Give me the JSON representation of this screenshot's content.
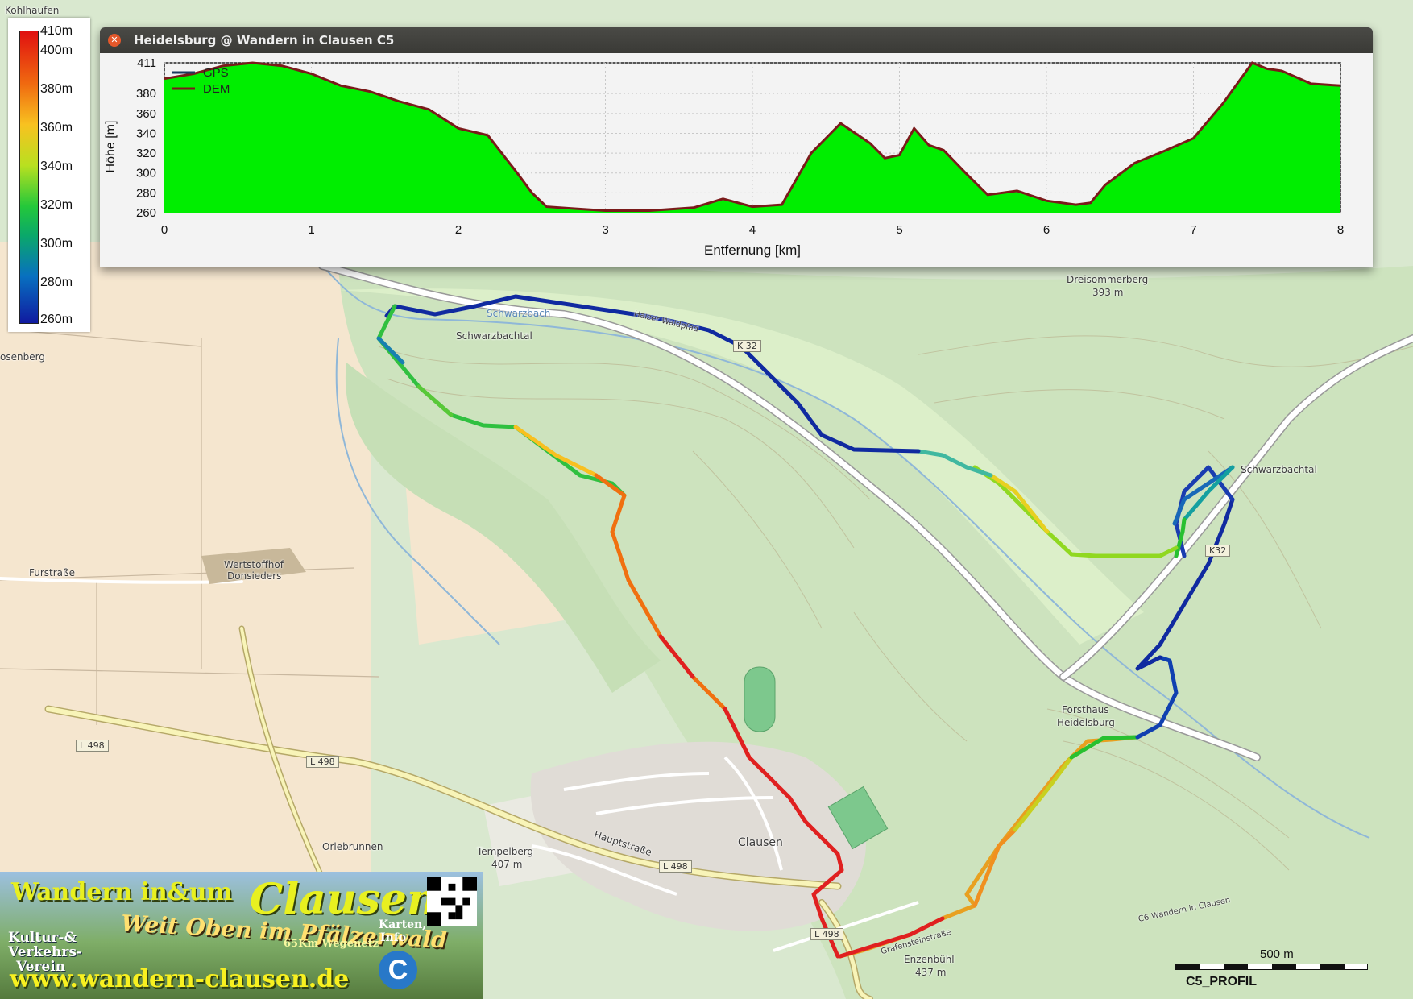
{
  "window": {
    "title": "Heidelsburg @ Wandern in Clausen C5"
  },
  "legend": {
    "ticks": [
      "410m",
      "400m",
      "380m",
      "360m",
      "340m",
      "320m",
      "300m",
      "280m",
      "260m"
    ]
  },
  "profile": {
    "ylabel": "Höhe [m]",
    "xlabel": "Entfernung [km]",
    "series_gps": "GPS",
    "series_dem": "DEM",
    "y_ticks": [
      "411",
      "380",
      "360",
      "340",
      "320",
      "300",
      "280",
      "260"
    ],
    "x_ticks": [
      "0",
      "1",
      "2",
      "3",
      "4",
      "5",
      "6",
      "7",
      "8"
    ]
  },
  "chart_data": {
    "type": "area",
    "xlabel": "Entfernung [km]",
    "ylabel": "Höhe [m]",
    "xlim": [
      0,
      8
    ],
    "ylim": [
      260,
      411
    ],
    "grid": true,
    "legend_position": "top-left",
    "series": [
      {
        "name": "DEM",
        "x": [
          0,
          0.2,
          0.4,
          0.6,
          0.8,
          1.0,
          1.2,
          1.4,
          1.6,
          1.8,
          2.0,
          2.2,
          2.4,
          2.5,
          2.6,
          2.8,
          3.0,
          3.3,
          3.6,
          3.8,
          4.0,
          4.2,
          4.4,
          4.6,
          4.8,
          4.9,
          5.0,
          5.1,
          5.2,
          5.3,
          5.45,
          5.6,
          5.8,
          6.0,
          6.2,
          6.3,
          6.4,
          6.6,
          6.8,
          7.0,
          7.2,
          7.4,
          7.5,
          7.6,
          7.8,
          8.0
        ],
        "values": [
          395,
          400,
          408,
          411,
          408,
          400,
          388,
          382,
          372,
          364,
          345,
          338,
          300,
          280,
          266,
          264,
          262,
          262,
          265,
          274,
          266,
          268,
          320,
          350,
          330,
          315,
          318,
          345,
          328,
          323,
          300,
          278,
          282,
          272,
          268,
          270,
          288,
          310,
          322,
          335,
          370,
          411,
          405,
          403,
          390,
          388
        ]
      }
    ]
  },
  "map_labels": {
    "kohlhaufen": "Kohlhaufen",
    "rosenberg": "osenberg",
    "schwarzbachtal_w": "Schwarzbachtal",
    "schwarzbach": "Schwarzbach",
    "halzer": "Haizer Waldpfad",
    "k32a": "K 32",
    "k32b": "K32",
    "dreisommerberg": "Dreisommerberg",
    "dreisommerberg_h": "393 m",
    "schwarzbachtal_e": "Schwarzbachtal",
    "wertstoffhof": "Wertstoffhof",
    "donsieders": "Donsieders",
    "furstrasse": "Furstraße",
    "forsthaus": "Forsthaus",
    "heidelsburg": "Heidelsburg",
    "l498a": "L 498",
    "l498b": "L 498",
    "l498c": "L 498",
    "l498d": "L 498",
    "clausen": "Clausen",
    "hauptstrasse": "Hauptstraße",
    "tempelberg": "Tempelberg",
    "tempelberg_h": "407 m",
    "orlebrunnen": "Orlebrunnen",
    "enzenbuhl": "Enzenbühl",
    "enzenbuhl_h": "437 m",
    "c5wandern": "C6 Wandern in Clausen",
    "grafenstein": "Grafensteinstraße",
    "scale": "500 m"
  },
  "banner": {
    "line1": "Wandern in&um",
    "clausen": "Clausen",
    "slogan": "Weit Oben im Pfälzerwald",
    "km": "65Km Wegenetz",
    "kultur": "Kultur-&",
    "verkehrs": "Verkehrs-",
    "verein": "Verein",
    "karten": "Karten,",
    "info": "Info",
    "url": "www.wandern-clausen.de"
  },
  "footer": {
    "code": "C5_PROFIL"
  },
  "colors": {
    "profile_fill": "#00ee00",
    "dem_line": "#7a1a1a",
    "gps_line": "#1a3a60"
  }
}
